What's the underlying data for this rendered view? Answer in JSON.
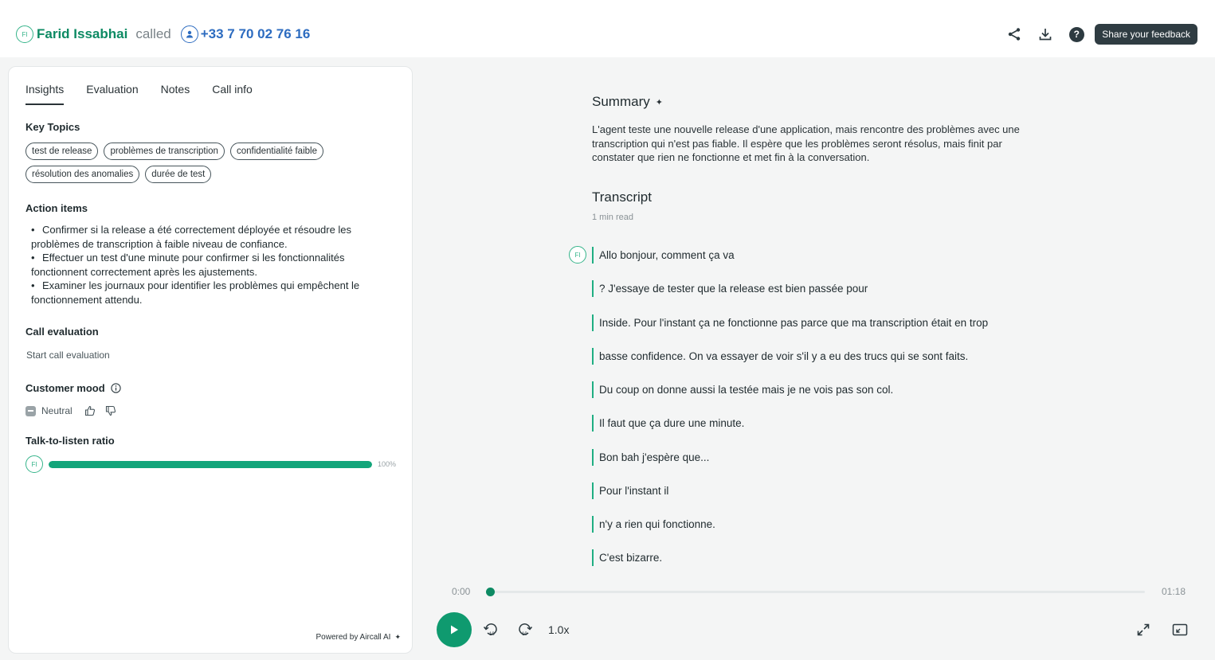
{
  "header": {
    "caller_initials": "FI",
    "caller_name": "Farid Issabhai",
    "called_word": "called",
    "phone": "+33 7 70 02 76 16",
    "feedback_label": "Share your feedback"
  },
  "tabs": [
    {
      "label": "Insights",
      "active": true
    },
    {
      "label": "Evaluation",
      "active": false
    },
    {
      "label": "Notes",
      "active": false
    },
    {
      "label": "Call info",
      "active": false
    }
  ],
  "key_topics": {
    "title": "Key Topics",
    "items": [
      "test de release",
      "problèmes de transcription",
      "confidentialité faible",
      "résolution des anomalies",
      "durée de test"
    ]
  },
  "action_items": {
    "title": "Action items",
    "items": [
      "Confirmer si la release a été correctement déployée et résoudre les problèmes de transcription à faible niveau de confiance.",
      "Effectuer un test d'une minute pour confirmer si les fonctionnalités fonctionnent correctement après les ajustements.",
      "Examiner les journaux pour identifier les problèmes qui empêchent le fonctionnement attendu."
    ]
  },
  "call_evaluation": {
    "title": "Call evaluation",
    "link": "Start call evaluation"
  },
  "customer_mood": {
    "title": "Customer mood",
    "value": "Neutral"
  },
  "talk_ratio": {
    "title": "Talk-to-listen ratio",
    "speaker_initials": "FI",
    "percent_label": "100%",
    "value": 1.0
  },
  "powered_by": "Powered by Aircall AI",
  "summary": {
    "title": "Summary",
    "text": "L'agent teste une nouvelle release d'une application, mais rencontre des problèmes avec une transcription qui n'est pas fiable. Il espère que les problèmes seront résolus, mais finit par constater que rien ne fonctionne et met fin à la conversation."
  },
  "transcript": {
    "title": "Transcript",
    "read_time": "1 min read",
    "speaker_initials": "FI",
    "lines": [
      "Allo bonjour, comment ça va",
      "? J'essaye de tester que la release est bien passée pour",
      "Inside. Pour l'instant ça ne fonctionne pas parce que ma transcription était en trop",
      "basse confidence. On va essayer de voir s'il y a eu des trucs qui se sont faits.",
      "Du coup on donne aussi la testée mais je ne vois pas son col.",
      "Il faut que ça dure une minute.",
      "Bon bah j'espère que...",
      "Pour l'instant il",
      "n'y a rien qui fonctionne.",
      "C'est bizarre."
    ]
  },
  "player": {
    "current_time": "0:00",
    "total_time": "01:18",
    "progress": 0.0,
    "speed": "1.0x"
  },
  "colors": {
    "accent_green": "#0d8a63",
    "phone_blue": "#2d6cc0",
    "bar_green": "#12a57a"
  }
}
